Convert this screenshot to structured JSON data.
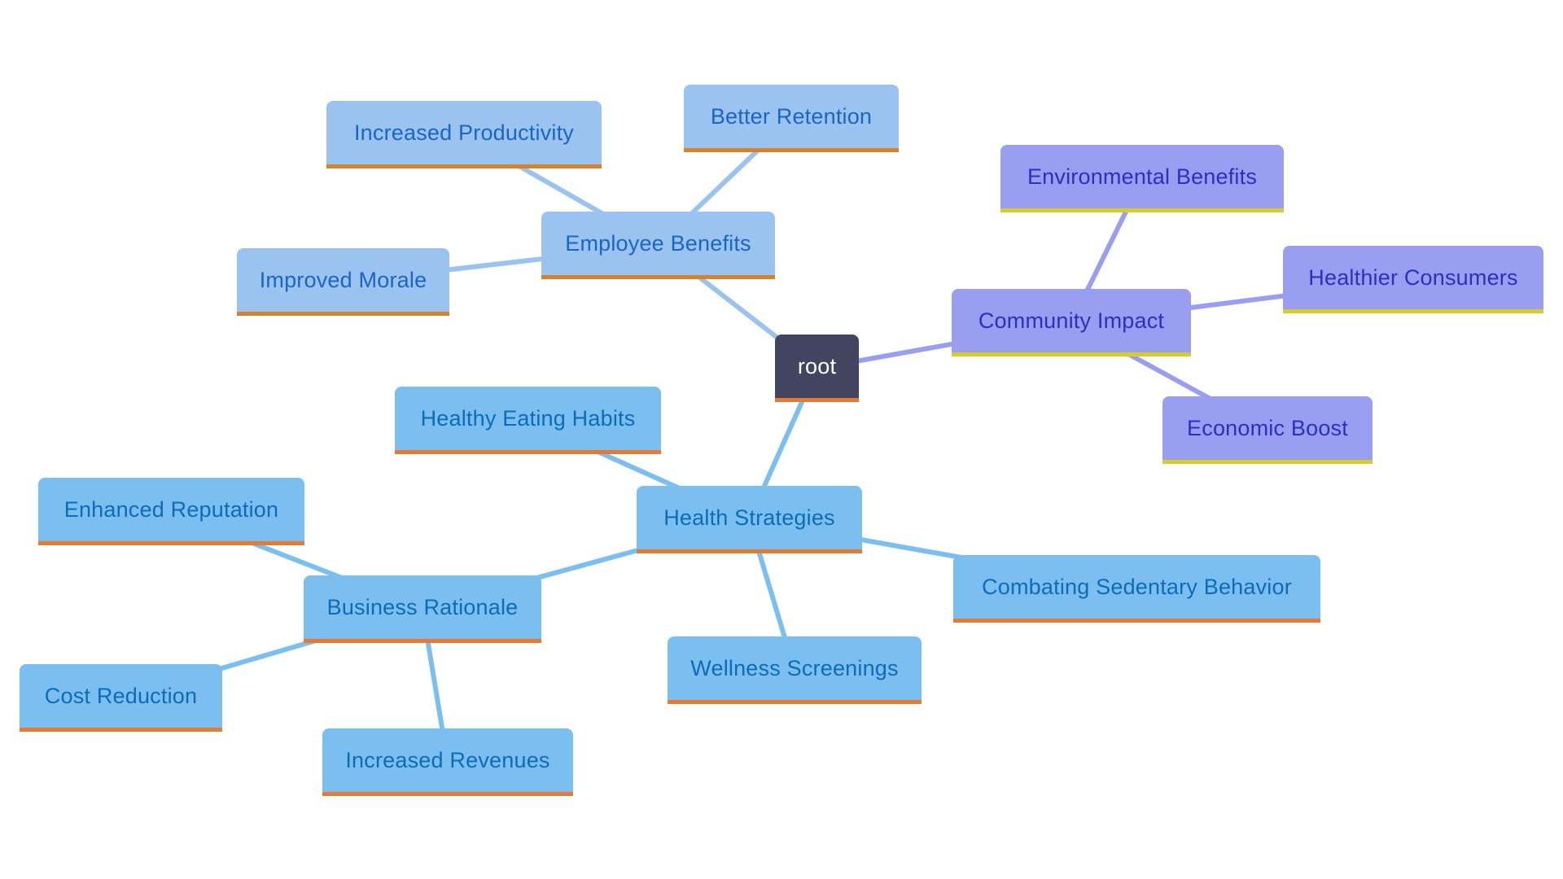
{
  "diagram": {
    "type": "mindmap",
    "root": {
      "id": "root",
      "label": "root"
    },
    "branches": [
      {
        "id": "employee-benefits",
        "label": "Employee Benefits",
        "theme": "emp",
        "colors": {
          "fill": "#9ac3ef",
          "text": "#1a66c4",
          "underline": "#d4832a",
          "edge": "#9ac3ef"
        },
        "children": [
          {
            "id": "increased-productivity",
            "label": "Increased Productivity"
          },
          {
            "id": "better-retention",
            "label": "Better Retention"
          },
          {
            "id": "improved-morale",
            "label": "Improved Morale"
          }
        ]
      },
      {
        "id": "community-impact",
        "label": "Community Impact",
        "theme": "comm",
        "colors": {
          "fill": "#999ef1",
          "text": "#2a30c2",
          "underline": "#d8cc2c",
          "edge": "#999ef1"
        },
        "children": [
          {
            "id": "environmental-benefits",
            "label": "Environmental Benefits"
          },
          {
            "id": "healthier-consumers",
            "label": "Healthier Consumers"
          },
          {
            "id": "economic-boost",
            "label": "Economic Boost"
          }
        ]
      },
      {
        "id": "health-strategies",
        "label": "Health Strategies",
        "theme": "health",
        "colors": {
          "fill": "#7abff0",
          "text": "#0d6bb8",
          "underline": "#e57b33",
          "edge": "#7abff0"
        },
        "children": [
          {
            "id": "healthy-eating-habits",
            "label": "Healthy Eating Habits"
          },
          {
            "id": "combating-sedentary-behavior",
            "label": "Combating Sedentary Behavior"
          },
          {
            "id": "wellness-screenings",
            "label": "Wellness Screenings"
          },
          {
            "id": "business-rationale",
            "label": "Business Rationale",
            "children": [
              {
                "id": "enhanced-reputation",
                "label": "Enhanced Reputation"
              },
              {
                "id": "cost-reduction",
                "label": "Cost Reduction"
              },
              {
                "id": "increased-revenues",
                "label": "Increased Revenues"
              }
            ]
          }
        ]
      }
    ],
    "root_colors": {
      "fill": "#424560",
      "text": "#ffffff",
      "underline": "#e57b33"
    }
  }
}
